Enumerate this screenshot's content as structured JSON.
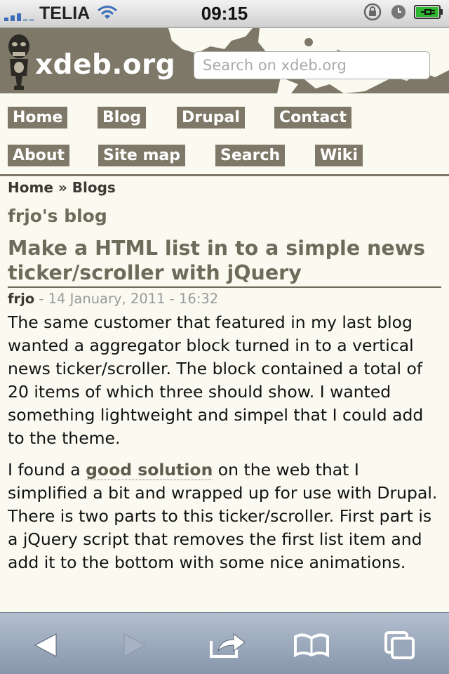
{
  "status_bar": {
    "carrier": "TELIA",
    "time": "09:15"
  },
  "header": {
    "site_name": "xdeb.org",
    "search_placeholder": "Search on xdeb.org"
  },
  "nav": {
    "items": [
      {
        "label": "Home"
      },
      {
        "label": "Blog"
      },
      {
        "label": "Drupal"
      },
      {
        "label": "Contact"
      },
      {
        "label": "About"
      },
      {
        "label": "Site map"
      },
      {
        "label": "Search"
      },
      {
        "label": "Wiki"
      }
    ]
  },
  "breadcrumb": {
    "home": "Home",
    "separator": "»",
    "blogs": "Blogs"
  },
  "blog_owner": "frjo's blog",
  "post": {
    "title": "Make a HTML list in to a simple news ticker/scroller with jQuery",
    "author": "frjo",
    "date": "- 14 January, 2011 - 16:32",
    "paragraph1": "The same customer that featured in my last blog wanted a aggregator block turned in to a vertical news ticker/scroller. The block contained a total of 20 items of which three should show. I wanted something lightweight and simpel that I could add to the theme.",
    "paragraph2_before": "I found a ",
    "paragraph2_link": "good solution",
    "paragraph2_after": " on the web that I simplified a bit and wrapped up for use with Drupal. There is two parts to this ticker/scroller. First part is a jQuery script that removes the first list item and add it to the bottom with some nice animations."
  },
  "colors": {
    "brand": "#7d7867",
    "background": "#fbfaf0",
    "toolbar": "#95a3b8"
  },
  "toolbar": {
    "icons": [
      "back-arrow-icon",
      "forward-arrow-icon",
      "share-icon",
      "bookmarks-icon",
      "tabs-icon"
    ]
  }
}
